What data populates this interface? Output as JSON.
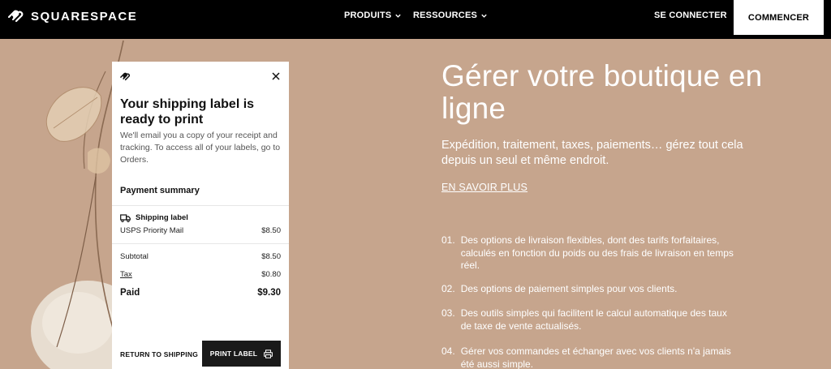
{
  "nav": {
    "brand": "SQUARESPACE",
    "products": "PRODUITS",
    "resources": "RESSOURCES",
    "login": "SE CONNECTER",
    "start": "COMMENCER"
  },
  "modal": {
    "title": "Your shipping label is ready to print",
    "description": "We'll email you a copy of your receipt and tracking. To access all of your labels, go to Orders.",
    "summary_heading": "Payment summary",
    "shipping_label": "Shipping label",
    "carrier": "USPS Priority Mail",
    "carrier_price": "$8.50",
    "subtotal_label": "Subtotal",
    "subtotal_value": "$8.50",
    "tax_label": "Tax",
    "tax_value": "$0.80",
    "paid_label": "Paid",
    "paid_value": "$9.30",
    "return_button": "RETURN TO SHIPPING",
    "print_button": "PRINT LABEL"
  },
  "hero": {
    "title": "Gérer votre boutique en ligne",
    "subtitle": "Expédition, traitement, taxes, paiements… gérez tout cela depuis un seul et même endroit.",
    "link": "EN SAVOIR PLUS",
    "features": [
      {
        "num": "01.",
        "text": "Des options de livraison flexibles, dont des tarifs forfaitaires, calculés en fonction du poids ou des frais de livraison en temps réel."
      },
      {
        "num": "02.",
        "text": "Des options de paiement simples pour vos clients."
      },
      {
        "num": "03.",
        "text": "Des outils simples qui facilitent le calcul automatique des taux de taxe de vente actualisés."
      },
      {
        "num": "04.",
        "text": "Gérer vos commandes et échanger avec vos clients n'a jamais été aussi simple."
      }
    ]
  },
  "colors": {
    "background": "#c6a58d",
    "nav": "#000000",
    "button_dark": "#1a1a1a"
  }
}
